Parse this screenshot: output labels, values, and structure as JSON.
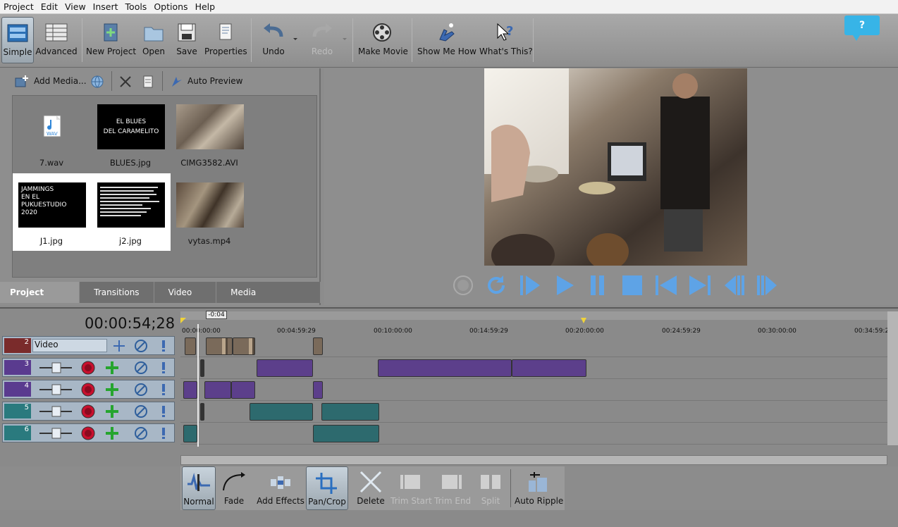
{
  "menu": [
    "Project",
    "Edit",
    "View",
    "Insert",
    "Tools",
    "Options",
    "Help"
  ],
  "toolbar": {
    "simple": "Simple",
    "advanced": "Advanced",
    "new_project": "New Project",
    "open": "Open",
    "save": "Save",
    "properties": "Properties",
    "undo": "Undo",
    "redo": "Redo",
    "make_movie": "Make Movie",
    "show_me_how": "Show Me How",
    "whats_this": "What's This?",
    "help": "?"
  },
  "media_toolbar": {
    "add_media": "Add Media...",
    "auto_preview": "Auto Preview"
  },
  "media": [
    {
      "name": "7.wav",
      "thumb_text": "WAV"
    },
    {
      "name": "BLUES.jpg",
      "thumb_text": "EL BLUES\nDEL CARAMELITO"
    },
    {
      "name": "CIMG3582.AVI",
      "thumb_text": ""
    },
    {
      "name": "J1.jpg",
      "thumb_text": "JAMMINGS\nEN EL\nPUKUESTUDIO\n2020"
    },
    {
      "name": "j2.jpg",
      "thumb_text": ""
    },
    {
      "name": "vytas.mp4",
      "thumb_text": ""
    }
  ],
  "tabs": [
    "Project Media",
    "Transitions",
    "Video FX",
    "Media Generators"
  ],
  "timeline": {
    "timecode": "00:00:54;28",
    "marker": "-0:04",
    "ruler": [
      "00:00:00:00",
      "00:04:59:29",
      "00:10:00:00",
      "00:14:59:29",
      "00:20:00:00",
      "00:24:59:29",
      "00:30:00:00",
      "00:34:59:2"
    ],
    "tracks": [
      {
        "num": "2",
        "name": "Video",
        "kind": "video"
      },
      {
        "num": "3",
        "name": "",
        "kind": "audio"
      },
      {
        "num": "4",
        "name": "",
        "kind": "audio"
      },
      {
        "num": "5",
        "name": "",
        "kind": "audio"
      },
      {
        "num": "6",
        "name": "",
        "kind": "audio"
      }
    ]
  },
  "edit_toolbar": {
    "normal": "Normal",
    "fade": "Fade",
    "add_effects": "Add Effects",
    "pan_crop": "Pan/Crop",
    "delete": "Delete",
    "trim_start": "Trim Start",
    "trim_end": "Trim End",
    "split": "Split",
    "auto_ripple": "Auto Ripple"
  }
}
